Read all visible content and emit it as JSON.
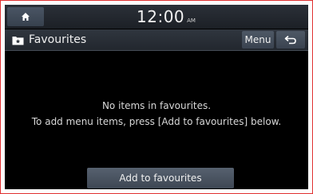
{
  "status_bar": {
    "time": "12:00",
    "ampm": "AM",
    "home_icon": "home-icon"
  },
  "title_bar": {
    "title": "Favourites",
    "title_icon": "favourites-folder-icon",
    "menu_label": "Menu",
    "back_icon": "back-arrow-icon"
  },
  "main": {
    "empty_line1": "No items in favourites.",
    "empty_line2": "To add menu items, press [Add to favourites] below."
  },
  "footer": {
    "add_label": "Add to favourites"
  },
  "colors": {
    "frame_border": "#e03030",
    "screen_bg": "#000000",
    "button_bg": "#4a5564",
    "text": "#f0f0f0"
  }
}
